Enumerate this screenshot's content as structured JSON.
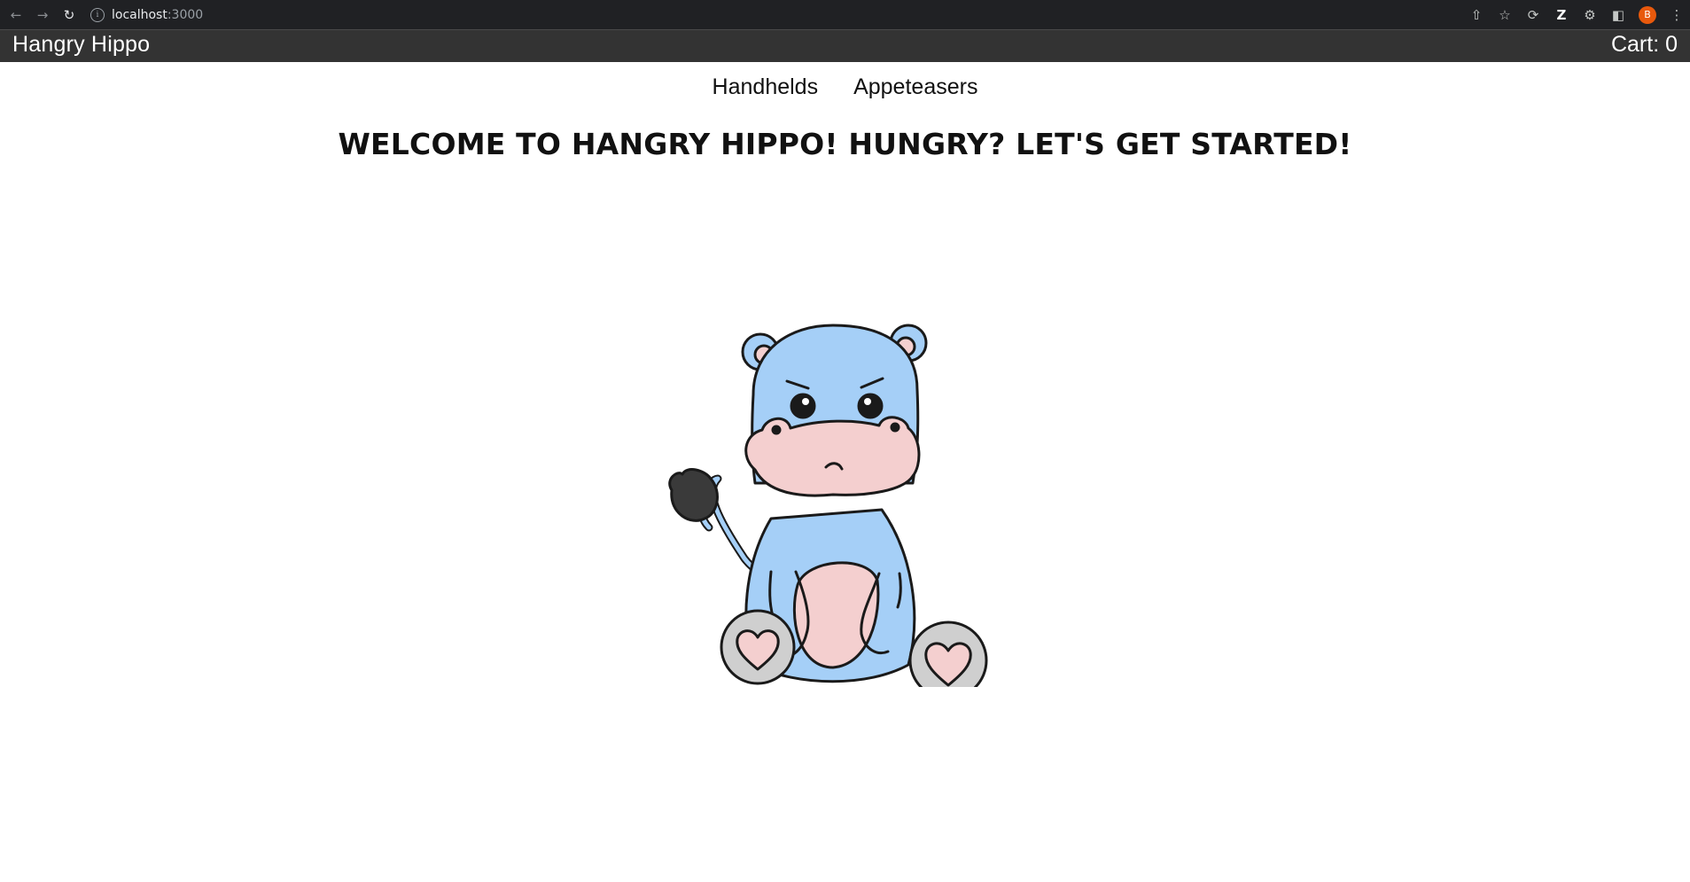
{
  "browser": {
    "url_host": "localhost",
    "url_port": ":3000",
    "avatar_letter": "B"
  },
  "header": {
    "brand": "Hangry Hippo",
    "cart": "Cart: 0"
  },
  "nav": {
    "items": [
      {
        "label": "Handhelds"
      },
      {
        "label": "Appeteasers"
      }
    ]
  },
  "main": {
    "welcome": "WELCOME TO HANGRY HIPPO! HUNGRY? LET'S GET STARTED!"
  },
  "colors": {
    "header_bg": "#333333",
    "hippo_body": "#a5cff7",
    "hippo_pink": "#f4cfcf",
    "hippo_outline": "#1a1a1a",
    "feet": "#cfcfcf"
  }
}
